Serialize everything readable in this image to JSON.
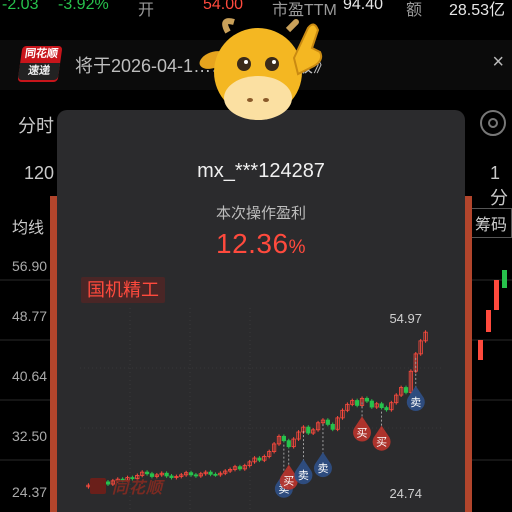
{
  "quote_strip": {
    "change": "-2.03",
    "change_pct": "-3.92%",
    "open_label": "开",
    "open_value": "54.00",
    "pe_label": "市盈TTM",
    "pe_value": "94.40",
    "amount_label": "额",
    "amount_value": "28.53亿"
  },
  "news": {
    "badge_top": "同花顺",
    "badge_bottom": "速递",
    "text": "将于2026-04-1……025年年报》",
    "close": "×"
  },
  "tabs": {
    "left": "分时",
    "right_partial": "1分"
  },
  "periods": {
    "left": "120",
    "right_partial": "1分"
  },
  "indicators": {
    "left": "均线",
    "right": "筹码"
  },
  "side_prices": [
    "56.90",
    "48.77",
    "40.64",
    "32.50",
    "24.37"
  ],
  "modal": {
    "username": "mx_***124287",
    "profit_label": "本次操作盈利",
    "profit_value": "12.36",
    "profit_unit": "%",
    "stock_name": "国机精工",
    "watermark": "同花顺",
    "chart_high_label": "54.97",
    "chart_low_label": "24.74",
    "buy_label": "买",
    "sell_label": "卖"
  },
  "colors": {
    "up": "#ff4a3d",
    "down": "#27c24c",
    "buy_marker": "#b8342c",
    "sell_marker": "#2f4f86"
  },
  "chart_data": {
    "type": "candlestick",
    "high": 54.97,
    "low": 24.74,
    "closes": [
      26.0,
      25.8,
      26.3,
      26.6,
      26.2,
      26.8,
      27.1,
      26.9,
      27.4,
      27.2,
      27.8,
      28.4,
      28.1,
      27.6,
      27.9,
      28.2,
      27.7,
      27.4,
      27.6,
      27.9,
      28.3,
      27.9,
      27.7,
      28.1,
      28.4,
      28.0,
      27.9,
      28.2,
      28.6,
      28.9,
      29.4,
      29.0,
      29.6,
      30.3,
      31.0,
      30.6,
      31.3,
      32.2,
      33.6,
      35.0,
      34.2,
      33.1,
      34.5,
      35.8,
      36.7,
      35.6,
      36.2,
      37.5,
      38.0,
      37.2,
      36.3,
      38.4,
      39.8,
      40.9,
      41.6,
      40.7,
      42.0,
      41.5,
      40.4,
      41.0,
      40.3,
      39.9,
      41.2,
      42.6,
      44.0,
      43.1,
      47.0,
      50.2,
      52.6,
      54.2
    ],
    "trades": [
      {
        "type": "sell",
        "index": 40
      },
      {
        "type": "buy",
        "index": 41
      },
      {
        "type": "sell",
        "index": 44
      },
      {
        "type": "sell",
        "index": 48
      },
      {
        "type": "buy",
        "index": 56
      },
      {
        "type": "buy",
        "index": 60
      },
      {
        "type": "sell",
        "index": 67
      }
    ]
  }
}
